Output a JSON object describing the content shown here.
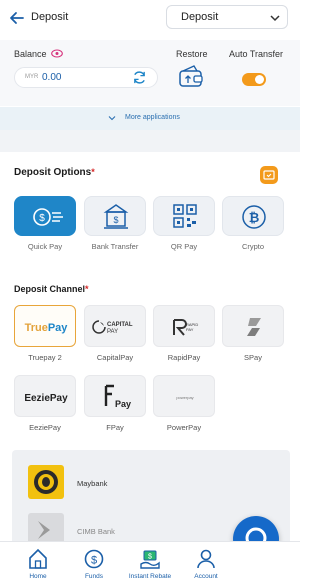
{
  "header": {
    "title": "Deposit",
    "select_value": "Deposit"
  },
  "balance": {
    "label": "Balance",
    "currency": "MYR",
    "value": "0.00",
    "restore_label": "Restore",
    "auto_transfer_label": "Auto Transfer"
  },
  "more_applications": "More applications",
  "deposit_options": {
    "title": "Deposit Options",
    "required": "*",
    "items": [
      {
        "label": "Quick Pay",
        "icon": "quick-pay-icon"
      },
      {
        "label": "Bank Transfer",
        "icon": "bank-transfer-icon"
      },
      {
        "label": "QR Pay",
        "icon": "qr-code-icon"
      },
      {
        "label": "Crypto",
        "icon": "bitcoin-icon"
      }
    ]
  },
  "deposit_channel": {
    "title": "Deposit Channel",
    "required": "*",
    "items": [
      {
        "label": "Truepay 2",
        "logo": "TruePay"
      },
      {
        "label": "CapitalPay",
        "logo": "CAPITAL PAY"
      },
      {
        "label": "RapidPay",
        "logo": "RAPID PAY"
      },
      {
        "label": "SPay",
        "logo": ""
      },
      {
        "label": "EeziePay",
        "logo": "EeziePay"
      },
      {
        "label": "FPay",
        "logo": "Pay"
      },
      {
        "label": "PowerPay",
        "logo": "powerpay"
      }
    ]
  },
  "banks": [
    {
      "name": "Maybank"
    },
    {
      "name": "CIMB Bank"
    }
  ],
  "bottom_nav": [
    {
      "label": "Home",
      "icon": "home-icon"
    },
    {
      "label": "Funds",
      "icon": "dollar-coin-icon"
    },
    {
      "label": "Instant Rebate",
      "icon": "rebate-icon"
    },
    {
      "label": "Account",
      "icon": "user-icon"
    }
  ],
  "colors": {
    "accent": "#1f86c8",
    "orange": "#f39a1b",
    "link": "#2a6fb0",
    "required": "#d62626"
  }
}
